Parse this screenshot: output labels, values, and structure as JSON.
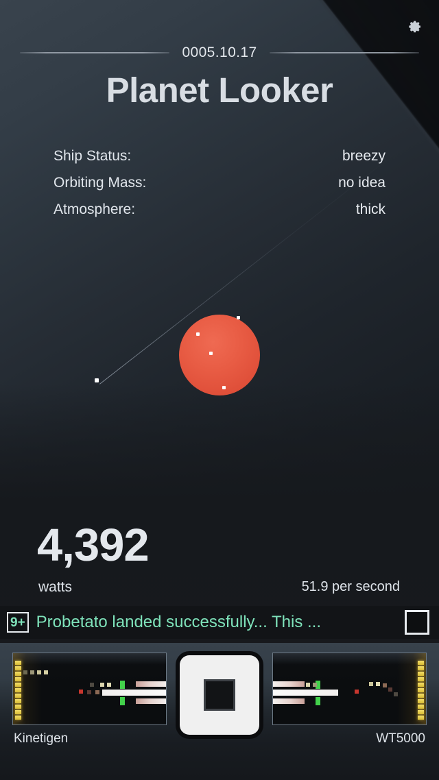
{
  "header": {
    "settings_icon": "gear-icon",
    "date": "0005.10.17",
    "title": "Planet Looker"
  },
  "status": {
    "rows": [
      {
        "label": "Ship Status:",
        "value": "breezy"
      },
      {
        "label": "Orbiting Mass:",
        "value": "no idea"
      },
      {
        "label": "Atmosphere:",
        "value": "thick"
      }
    ]
  },
  "viewport": {
    "planet_color": "#e85c44",
    "planet_markers": 4,
    "star_markers": 1
  },
  "energy": {
    "value": "4,392",
    "unit": "watts",
    "rate": "51.9 per second"
  },
  "notification": {
    "badge": "9+",
    "badge_color": "#7fe3bb",
    "message": "Probetato landed successfully... This ...",
    "checkbox_checked": false
  },
  "toolbar": {
    "left_panel_label": "Kinetigen",
    "right_panel_label": "WT5000",
    "center_button_icon": "stop-square-icon"
  }
}
